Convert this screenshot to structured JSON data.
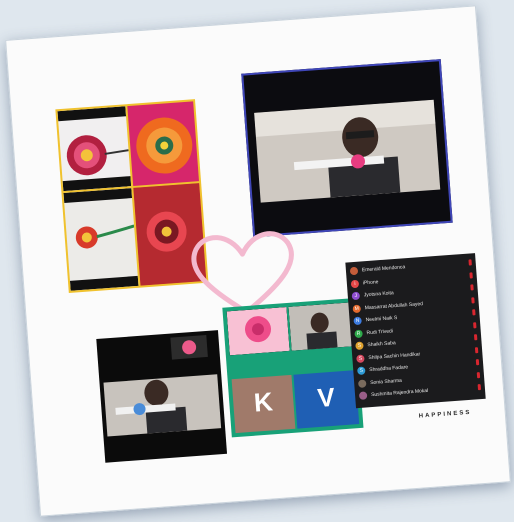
{
  "participants": [
    {
      "name": "Emerald Mendonca",
      "initial": "",
      "color": "#c45d3a"
    },
    {
      "name": "iPhone",
      "initial": "i",
      "color": "#e44848"
    },
    {
      "name": "Jyotsna Koita",
      "initial": "J",
      "color": "#8e4ecf"
    },
    {
      "name": "Massarrat Abdullah Sayed",
      "initial": "M",
      "color": "#e46a2e"
    },
    {
      "name": "Neelmi Naik S",
      "initial": "N",
      "color": "#3c7be0"
    },
    {
      "name": "Rudi Trivedi",
      "initial": "R",
      "color": "#2eaa4b"
    },
    {
      "name": "Shaikh Saba",
      "initial": "S",
      "color": "#e0a22e"
    },
    {
      "name": "Shilpa Sachin Handikar",
      "initial": "S",
      "color": "#d4485e"
    },
    {
      "name": "Shraddha Fadare",
      "initial": "S",
      "color": "#2e9bd6"
    },
    {
      "name": "Sonia Sharma",
      "initial": "",
      "color": "#7a6b5d"
    },
    {
      "name": "Sushmita Rajendra Mokal",
      "initial": "",
      "color": "#9a5e88"
    }
  ],
  "grid": {
    "tile_k_letter": "K",
    "tile_v_letter": "V"
  },
  "caption": "HAPPINESS"
}
